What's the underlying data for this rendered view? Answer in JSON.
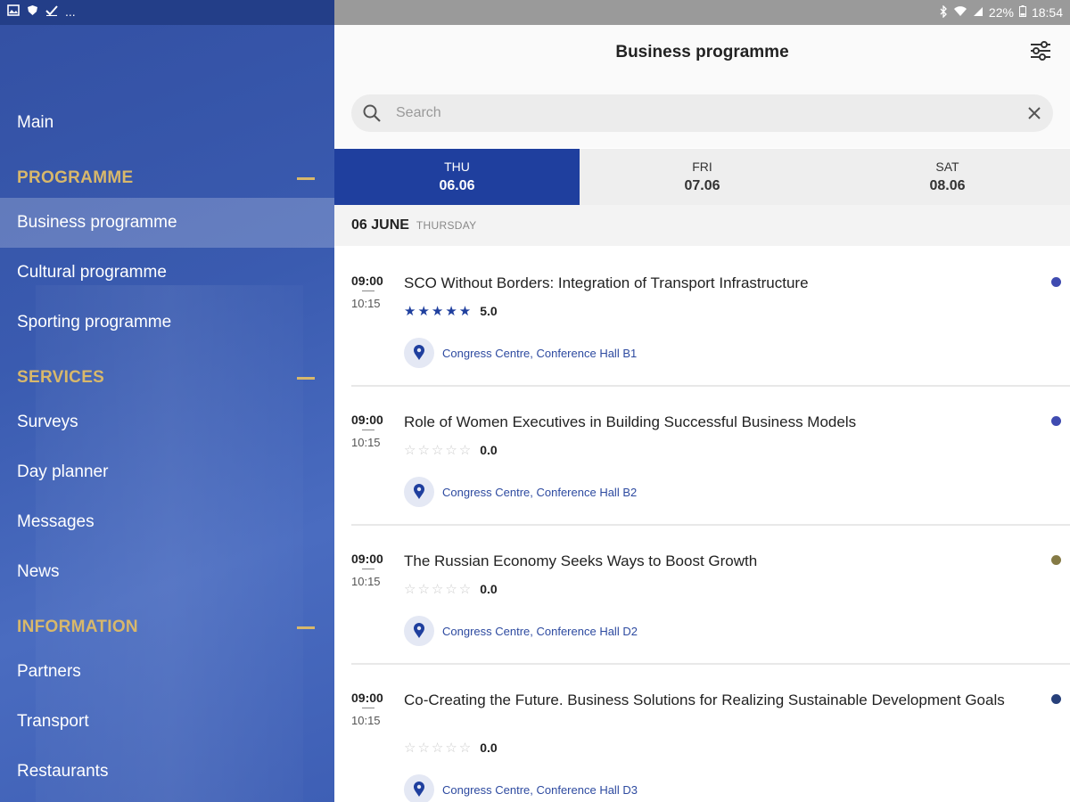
{
  "status_bar": {
    "left_icons": [
      "image-icon",
      "shield-icon",
      "check-icon",
      "more-dots"
    ],
    "left_more": "...",
    "battery": "22%",
    "time": "18:54"
  },
  "sidebar": {
    "main": "Main",
    "sections": [
      {
        "title": "PROGRAMME",
        "items": [
          "Business programme",
          "Cultural programme",
          "Sporting programme"
        ]
      },
      {
        "title": "SERVICES",
        "items": [
          "Surveys",
          "Day planner",
          "Messages",
          "News"
        ]
      },
      {
        "title": "INFORMATION",
        "items": [
          "Partners",
          "Transport",
          "Restaurants"
        ]
      }
    ],
    "active_item": "Business programme"
  },
  "header": {
    "title": "Business programme"
  },
  "search": {
    "placeholder": "Search",
    "value": ""
  },
  "tabs": [
    {
      "dow": "THU",
      "date": "06.06",
      "active": true
    },
    {
      "dow": "FRI",
      "date": "07.06",
      "active": false
    },
    {
      "dow": "SAT",
      "date": "08.06",
      "active": false
    }
  ],
  "day_header": {
    "date": "06 JUNE",
    "weekday": "THURSDAY"
  },
  "events": [
    {
      "start": "09:00",
      "end": "10:15",
      "title": "SCO Without Borders: Integration of Transport Infrastructure",
      "stars_filled": "★★★★★",
      "stars_empty": "",
      "rating": "5.0",
      "location": "Congress Centre, Conference Hall B1",
      "dot_color": "#3f4bb0"
    },
    {
      "start": "09:00",
      "end": "10:15",
      "title": "Role of Women Executives in Building Successful Business Models",
      "stars_filled": "",
      "stars_empty": "☆☆☆☆☆",
      "rating": "0.0",
      "location": "Congress Centre, Conference Hall B2",
      "dot_color": "#3f4bb0"
    },
    {
      "start": "09:00",
      "end": "10:15",
      "title": "The Russian Economy Seeks Ways to Boost Growth",
      "stars_filled": "",
      "stars_empty": "☆☆☆☆☆",
      "rating": "0.0",
      "location": "Congress Centre, Conference Hall D2",
      "dot_color": "#857a45"
    },
    {
      "start": "09:00",
      "end": "10:15",
      "title": "Co-Creating the Future. Business Solutions for Realizing Sustainable Development Goals",
      "stars_filled": "",
      "stars_empty": "☆☆☆☆☆",
      "rating": "0.0",
      "location": "Congress Centre, Conference Hall D3",
      "dot_color": "#27407a"
    }
  ],
  "colors": {
    "accent": "#1f3f9e",
    "section": "#d8b86b",
    "sidebar": "#3a5bb0"
  }
}
